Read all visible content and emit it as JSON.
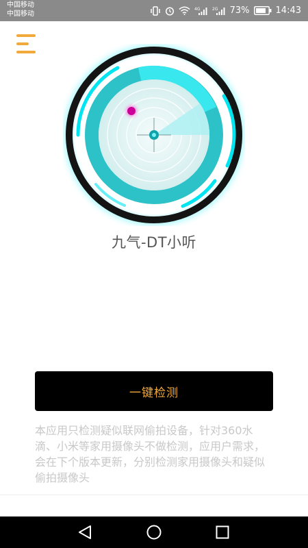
{
  "status_bar": {
    "carrier_1": "中国移动",
    "carrier_2": "中国移动",
    "battery": "73%",
    "time": "14:43",
    "icons": [
      "vibrate-icon",
      "alarm-icon",
      "wifi-icon",
      "signal-4g-icon",
      "signal-2g-icon",
      "battery-icon"
    ]
  },
  "header": {
    "menu_icon": "hamburger-menu-icon"
  },
  "radar": {
    "icon": "radar-scanner-icon",
    "accent_color": "#00e5f0",
    "target_dot_color": "#cc0099"
  },
  "app": {
    "title": "九气-DT小听"
  },
  "actions": {
    "detect_label": "一键检测"
  },
  "description": "本应用只检测疑似联网偷拍设备，针对360水滴、小米等家用摄像头不做检测，应用户需求，会在下个版本更新，分别检测家用摄像头和疑似偷拍摄像头",
  "colors": {
    "accent": "#f2a93b",
    "button_bg": "#000000",
    "status_bar_bg": "#8a8a8a",
    "description_text": "#c8c8c8"
  },
  "nav_bar": {
    "back_icon": "back-triangle-icon",
    "home_icon": "home-circle-icon",
    "recent_icon": "recent-apps-icon"
  }
}
